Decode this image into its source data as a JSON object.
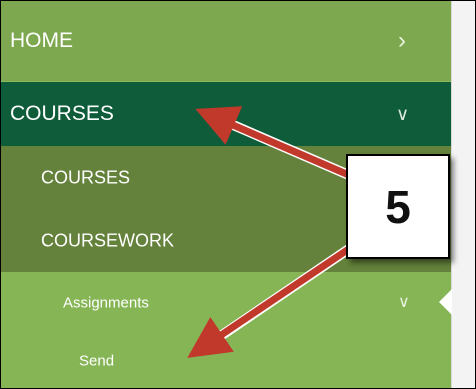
{
  "nav": {
    "home_label": "HOME",
    "courses_label": "COURSES",
    "courses_sub_label": "COURSES",
    "coursework_label": "COURSEWORK",
    "assignments_label": "Assignments",
    "send_label": "Send"
  },
  "icons": {
    "home_chevron": "chevron-right-icon",
    "courses_chevron": "chevron-down-icon",
    "assignments_chevron": "chevron-down-icon"
  },
  "callout": {
    "number": "5"
  },
  "colors": {
    "home_bg": "#7ea84f",
    "courses_bg": "#0e5c3a",
    "submenu_bg": "#64823b",
    "assignments_bg": "#86b556",
    "arrow": "#c0392b"
  }
}
